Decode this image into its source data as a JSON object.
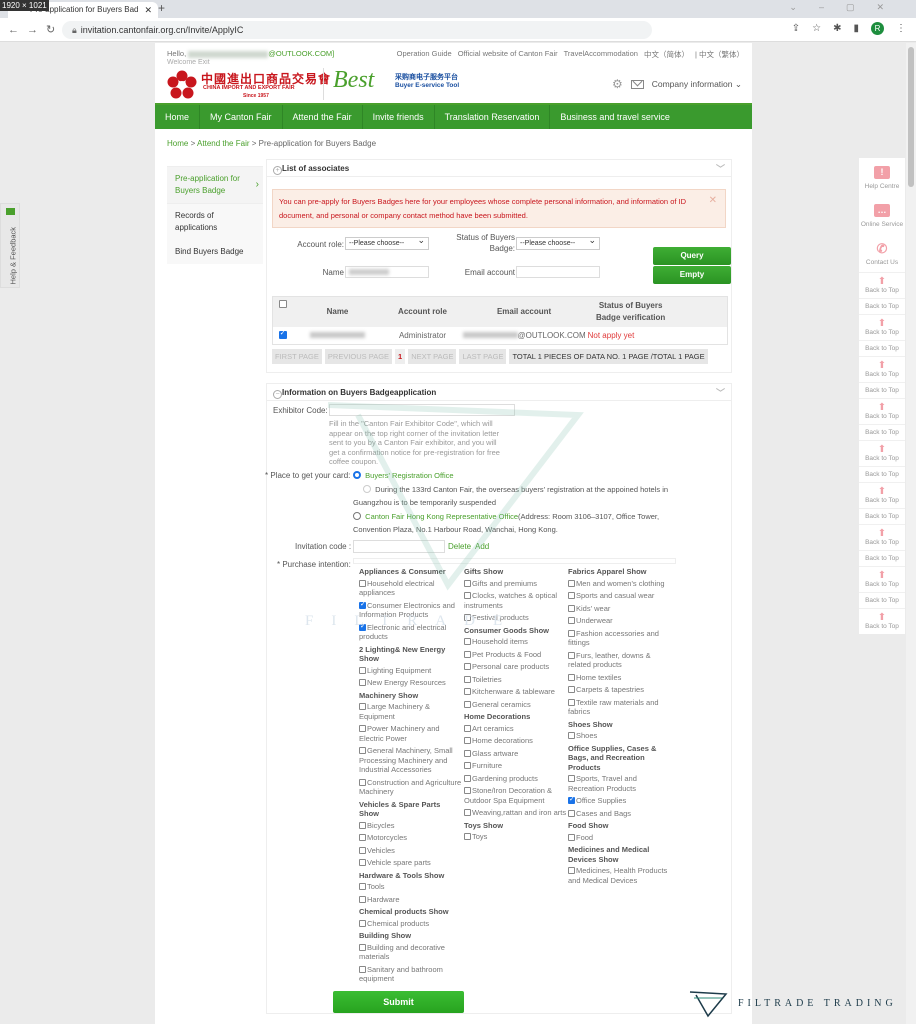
{
  "browser": {
    "dimensions_badge": "1920 × 1021",
    "tab_title": "Pre-application for Buyers Bad",
    "url": "invitation.cantonfair.org.cn/Invite/ApplyIC",
    "profile_initial": "R"
  },
  "topbar": {
    "hello": "Hello,",
    "email_suffix": "@OUTLOOK.COM]",
    "welcome": "Welcome Exit",
    "links": [
      "Operation Guide",
      "Official website of Canton Fair",
      "TravelAccommodation",
      "中文（简体）",
      "| 中文（繁体）"
    ]
  },
  "logo": {
    "cn": "中國進出口商品交易會",
    "en": "CHINA IMPORT AND EXPORT FAIR",
    "since": "Since 1957",
    "best": "Best",
    "best_cn": "采购商电子服务平台",
    "best_en": "Buyer E-service Tool"
  },
  "header": {
    "company_info": "Company information ⌄"
  },
  "nav": [
    "Home",
    "My Canton Fair",
    "Attend the Fair",
    "Invite friends",
    "Translation Reservation",
    "Business and travel service"
  ],
  "breadcrumb": {
    "home": "Home",
    "sep": " > ",
    "attend": "Attend the Fair",
    "current": " > Pre-application for Buyers Badge"
  },
  "sidebar": [
    {
      "label": "Pre-application for Buyers Badge",
      "active": true
    },
    {
      "label": "Records of applications"
    },
    {
      "label": "Bind Buyers Badge"
    }
  ],
  "associates": {
    "title": "List of associates",
    "alert": "You can pre-apply for Buyers Badges here for your employees whose complete personal information, and information of ID document, and personal or company contact method have been submitted.",
    "account_role_label": "Account role:",
    "account_role_value": "--Please choose--",
    "status_label": "Status of Buyers Badge:",
    "status_value": "--Please choose--",
    "name_label": "Name",
    "email_label": "Email account",
    "query": "Query",
    "empty": "Empty",
    "columns": [
      "Name",
      "Account role",
      "Email account",
      "Status of Buyers Badge verification"
    ],
    "rows": [
      {
        "checked": true,
        "role": "Administrator",
        "email_suffix": "@OUTLOOK.COM",
        "status": "Not apply yet"
      }
    ],
    "pager": {
      "first": "FIRST PAGE",
      "prev": "PREVIOUS PAGE",
      "page": "1",
      "next": "NEXT PAGE",
      "last": "LAST PAGE",
      "total": "TOTAL 1 PIECES OF DATA NO. 1 PAGE /TOTAL 1 PAGE"
    }
  },
  "info": {
    "title": "Information on Buyers Badgeapplication",
    "exhibitor_code_label": "Exhibitor Code:",
    "exhibitor_hint": "Fill in the \"Canton Fair Exhibitor Code\", which will appear on the top right corner of the invitation letter sent to you by a Canton Fair exhibitor, and you will get a confirmation notice for pre-registration for free coffee coupon.",
    "place_label": "* Place to get your card:",
    "place_options": [
      {
        "label": "Buyers' Registration Office",
        "selected": true
      },
      {
        "label": "During the 133rd Canton Fair, the overseas buyers' registration at the appoined hotels in Guangzhou is to be temporarily suspended",
        "disabled": true
      },
      {
        "label": "Canton Fair Hong Kong Representative Office",
        "extra": "(Address: Room 3106–3107, Office Tower, Convention Plaza, No.1 Harbour Road, Wanchai, Hong Kong."
      }
    ],
    "invitation_label": "Invitation code :",
    "delete": "Delete",
    "add": "Add",
    "purchase_label": "* Purchase intention:",
    "submit": "Submit"
  },
  "purchase_columns": [
    [
      {
        "h": "Appliances & Consumer"
      },
      {
        "i": "Household electrical appliances"
      },
      {
        "i": "Consumer Electronics and Information Products",
        "c": true
      },
      {
        "i": "Electronic and electrical products",
        "c": true
      },
      {
        "h": "2 Lighting& New Energy Show"
      },
      {
        "i": "Lighting Equipment"
      },
      {
        "i": "New Energy Resources"
      },
      {
        "h": "Machinery Show"
      },
      {
        "i": "Large Machinery & Equipment"
      },
      {
        "i": "Power Machinery and Electric Power"
      },
      {
        "i": "General Machinery, Small Processing Machinery and Industrial Accessories"
      },
      {
        "i": "Construction and Agriculture Machinery"
      },
      {
        "h": "Vehicles & Spare Parts Show"
      },
      {
        "i": "Bicycles"
      },
      {
        "i": "Motorcycles"
      },
      {
        "i": "Vehicles"
      },
      {
        "i": "Vehicle spare parts"
      },
      {
        "h": "Hardware & Tools Show"
      },
      {
        "i": "Tools"
      },
      {
        "i": "Hardware"
      },
      {
        "h": "Chemical products Show"
      },
      {
        "i": "Chemical products"
      },
      {
        "h": "Building Show"
      },
      {
        "i": "Building and decorative materials"
      },
      {
        "i": "Sanitary and bathroom equipment"
      }
    ],
    [
      {
        "h": "Gifts Show"
      },
      {
        "i": "Gifts and premiums"
      },
      {
        "i": "Clocks, watches & optical instruments"
      },
      {
        "i": "Festival products"
      },
      {
        "h": "Consumer Goods Show"
      },
      {
        "i": "Household items"
      },
      {
        "i": "Pet Products & Food"
      },
      {
        "i": "Personal care products"
      },
      {
        "i": "Toiletries"
      },
      {
        "i": "Kitchenware & tableware"
      },
      {
        "i": "General ceramics"
      },
      {
        "h": "Home Decorations"
      },
      {
        "i": "Art ceramics"
      },
      {
        "i": "Home decorations"
      },
      {
        "i": "Glass artware"
      },
      {
        "i": "Furniture"
      },
      {
        "i": "Gardening products"
      },
      {
        "i": "Stone/Iron Decoration & Outdoor Spa Equipment"
      },
      {
        "i": "Weaving,rattan and iron arts"
      },
      {
        "h": "Toys Show"
      },
      {
        "i": "Toys"
      }
    ],
    [
      {
        "h": "Fabrics Apparel Show"
      },
      {
        "i": "Men and women's clothing"
      },
      {
        "i": "Sports and casual wear"
      },
      {
        "i": "Kids' wear"
      },
      {
        "i": "Underwear"
      },
      {
        "i": "Fashion accessories and fittings"
      },
      {
        "i": "Furs, leather, downs & related products"
      },
      {
        "i": "Home textiles"
      },
      {
        "i": "Carpets & tapestries"
      },
      {
        "i": "Textile raw materials and fabrics"
      },
      {
        "h": "Shoes Show"
      },
      {
        "i": "Shoes"
      },
      {
        "h": "Office Supplies, Cases & Bags, and Recreation Products"
      },
      {
        "i": "Sports, Travel and Recreation Products"
      },
      {
        "i": "Office Supplies",
        "c": true
      },
      {
        "i": "Cases and Bags"
      },
      {
        "h": "Food Show"
      },
      {
        "i": "Food"
      },
      {
        "h": "Medicines and Medical Devices Show"
      },
      {
        "i": "Medicines, Health Products and Medical Devices"
      }
    ]
  ],
  "rightbar": {
    "help": "Help Centre",
    "online": "Online Service",
    "contact": "Contact Us",
    "back_to_top": "Back to Top"
  },
  "feedback": "Help & Feedback",
  "watermark": {
    "text": "FILTRADE TRADING",
    "faint": "FILTRADE"
  }
}
